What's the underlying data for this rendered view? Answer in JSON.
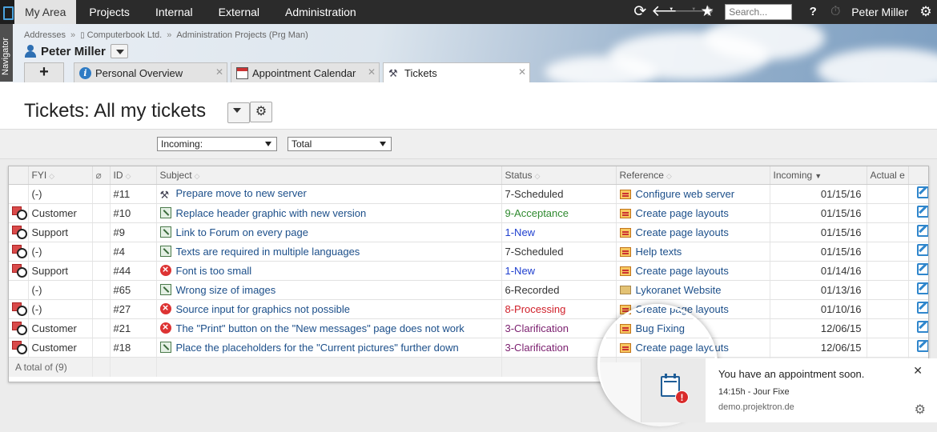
{
  "topnav": {
    "tabs": [
      "My Area",
      "Projects",
      "Internal",
      "External",
      "Administration"
    ],
    "search_placeholder": "Search...",
    "help": "?",
    "user": "Peter Miller"
  },
  "navigator_label": "Navigator",
  "breadcrumbs": [
    "Addresses",
    "Computerbook Ltd.",
    "Administration Projects (Prg Man)"
  ],
  "person_name": "Peter Miller",
  "doctabs": {
    "add": "+",
    "items": [
      {
        "label": "Personal Overview",
        "icon": "info-icon"
      },
      {
        "label": "Appointment Calendar",
        "icon": "calendar-icon"
      },
      {
        "label": "Tickets",
        "icon": "tools-icon"
      }
    ],
    "close": "✕"
  },
  "page": {
    "title": "Tickets: All my tickets"
  },
  "filters": {
    "incoming": "Incoming:",
    "total": "Total"
  },
  "table": {
    "columns": [
      "FYI",
      "ID",
      "Subject",
      "Status",
      "Reference",
      "Incoming",
      "Actual e"
    ],
    "rows": [
      {
        "fyi": false,
        "fyi_text": "(-)",
        "id": "#11",
        "subject_icon": "tool",
        "subject": "Prepare move to new server",
        "status": "7-Scheduled",
        "status_color": "gray",
        "ref_icon": "proj",
        "reference": "Configure web server",
        "incoming": "01/15/16"
      },
      {
        "fyi": true,
        "fyi_text": "Customer",
        "id": "#10",
        "subject_icon": "task",
        "subject": "Replace header graphic with new version",
        "status": "9-Acceptance",
        "status_color": "green",
        "ref_icon": "proj",
        "reference": "Create page layouts",
        "incoming": "01/15/16"
      },
      {
        "fyi": true,
        "fyi_text": "Support",
        "id": "#9",
        "subject_icon": "task",
        "subject": "Link to Forum on every page",
        "status": "1-New",
        "status_color": "blue",
        "ref_icon": "proj",
        "reference": "Create page layouts",
        "incoming": "01/15/16"
      },
      {
        "fyi": true,
        "fyi_text": "(-)",
        "id": "#4",
        "subject_icon": "task",
        "subject": "Texts are required in multiple languages",
        "status": "7-Scheduled",
        "status_color": "gray",
        "ref_icon": "proj",
        "reference": "Help texts",
        "incoming": "01/15/16"
      },
      {
        "fyi": true,
        "fyi_text": "Support",
        "id": "#44",
        "subject_icon": "bug",
        "subject": "Font is too small",
        "status": "1-New",
        "status_color": "blue",
        "ref_icon": "proj",
        "reference": "Create page layouts",
        "incoming": "01/14/16"
      },
      {
        "fyi": false,
        "fyi_text": "(-)",
        "id": "#65",
        "subject_icon": "task",
        "subject": "Wrong size of images",
        "status": "6-Recorded",
        "status_color": "gray",
        "ref_icon": "folder",
        "reference": "Lykoranet Website",
        "incoming": "01/13/16"
      },
      {
        "fyi": true,
        "fyi_text": "(-)",
        "id": "#27",
        "subject_icon": "bug",
        "subject": "Source input for graphics not possible",
        "status": "8-Processing",
        "status_color": "red",
        "ref_icon": "proj",
        "reference": "Create page layouts",
        "incoming": "01/10/16"
      },
      {
        "fyi": true,
        "fyi_text": "Customer",
        "id": "#21",
        "subject_icon": "bug",
        "subject": "The \"Print\" button on the \"New messages\" page does not work",
        "status": "3-Clarification",
        "status_color": "purple",
        "ref_icon": "proj",
        "reference": "Bug Fixing",
        "incoming": "12/06/15"
      },
      {
        "fyi": true,
        "fyi_text": "Customer",
        "id": "#18",
        "subject_icon": "task",
        "subject": "Place the placeholders for the \"Current pictures\" further down",
        "status": "3-Clarification",
        "status_color": "purple",
        "ref_icon": "proj",
        "reference": "Create page layouts",
        "incoming": "12/06/15"
      }
    ],
    "footer": "A total of (9)"
  },
  "notification": {
    "title": "You have an appointment soon.",
    "time": "14:15h - Jour Fixe",
    "site": "demo.projektron.de",
    "close": "✕"
  }
}
